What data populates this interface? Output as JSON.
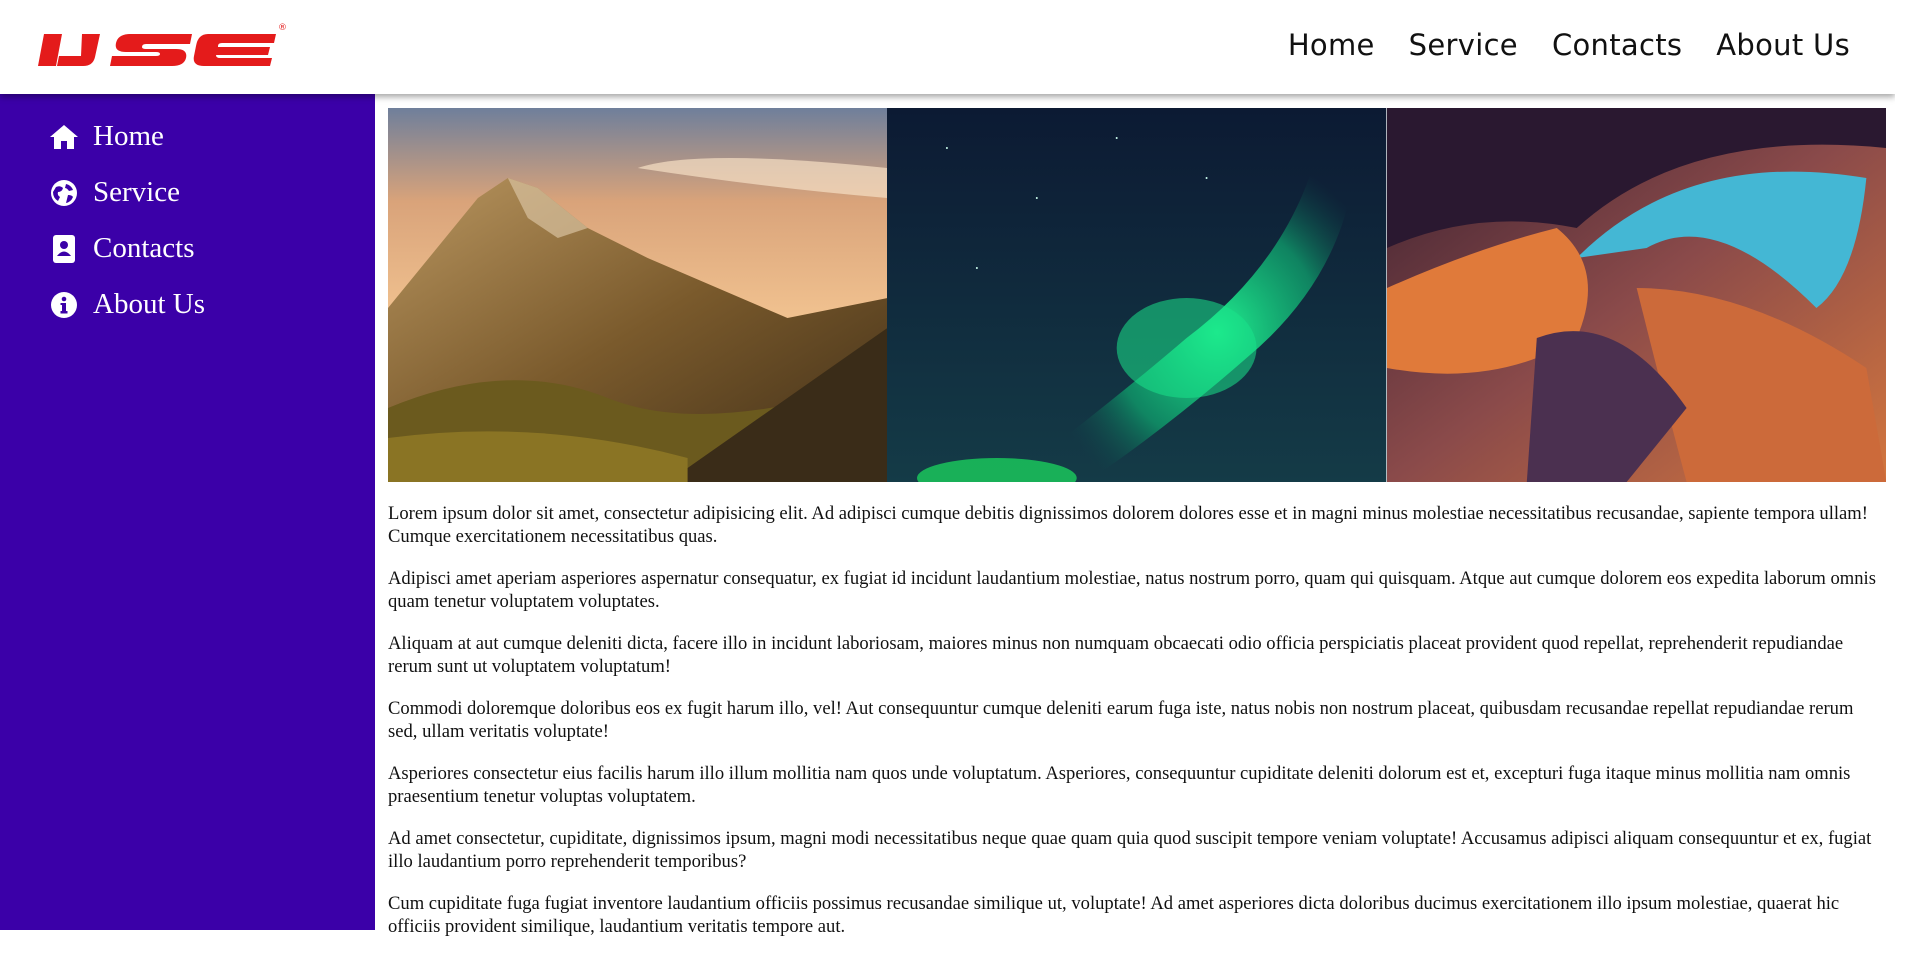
{
  "brand": {
    "logo_text": "IJSE",
    "registered_mark": "®",
    "color": "#e41b1b"
  },
  "top_nav": [
    {
      "label": "Home"
    },
    {
      "label": "Service"
    },
    {
      "label": "Contacts"
    },
    {
      "label": "About Us"
    }
  ],
  "sidebar": {
    "background": "#3b00a8",
    "items": [
      {
        "label": "Home",
        "icon": "home-icon"
      },
      {
        "label": "Service",
        "icon": "globe-icon"
      },
      {
        "label": "Contacts",
        "icon": "address-book-icon"
      },
      {
        "label": "About Us",
        "icon": "info-circle-icon"
      }
    ]
  },
  "gallery": [
    {
      "subject": "mountain-sunset"
    },
    {
      "subject": "aurora-borealis"
    },
    {
      "subject": "sandstone-canyon"
    }
  ],
  "paragraphs": [
    "Lorem ipsum dolor sit amet, consectetur adipisicing elit. Ad adipisci cumque debitis dignissimos dolorem dolores esse et in magni minus molestiae necessitatibus recusandae, sapiente tempora ullam! Cumque exercitationem necessitatibus quas.",
    "Adipisci amet aperiam asperiores aspernatur consequatur, ex fugiat id incidunt laudantium molestiae, natus nostrum porro, quam qui quisquam. Atque aut cumque dolorem eos expedita laborum omnis quam tenetur voluptatem voluptates.",
    "Aliquam at aut cumque deleniti dicta, facere illo in incidunt laboriosam, maiores minus non numquam obcaecati odio officia perspiciatis placeat provident quod repellat, reprehenderit repudiandae rerum sunt ut voluptatem voluptatum!",
    "Commodi doloremque doloribus eos ex fugit harum illo, vel! Aut consequuntur cumque deleniti earum fuga iste, natus nobis non nostrum placeat, quibusdam recusandae repellat repudiandae rerum sed, ullam veritatis voluptate!",
    "Asperiores consectetur eius facilis harum illo illum mollitia nam quos unde voluptatum. Asperiores, consequuntur cupiditate deleniti dolorum est et, excepturi fuga itaque minus mollitia nam omnis praesentium tenetur voluptas voluptatem.",
    "Ad amet consectetur, cupiditate, dignissimos ipsum, magni modi necessitatibus neque quae quam quia quod suscipit tempore veniam voluptate! Accusamus adipisci aliquam consequuntur et ex, fugiat illo laudantium porro reprehenderit temporibus?",
    "Cum cupiditate fuga fugiat inventore laudantium officiis possimus recusandae similique ut, voluptate! Ad amet asperiores dicta doloribus ducimus exercitationem illo ipsum molestiae, quaerat hic officiis provident similique, laudantium veritatis tempore aut."
  ]
}
